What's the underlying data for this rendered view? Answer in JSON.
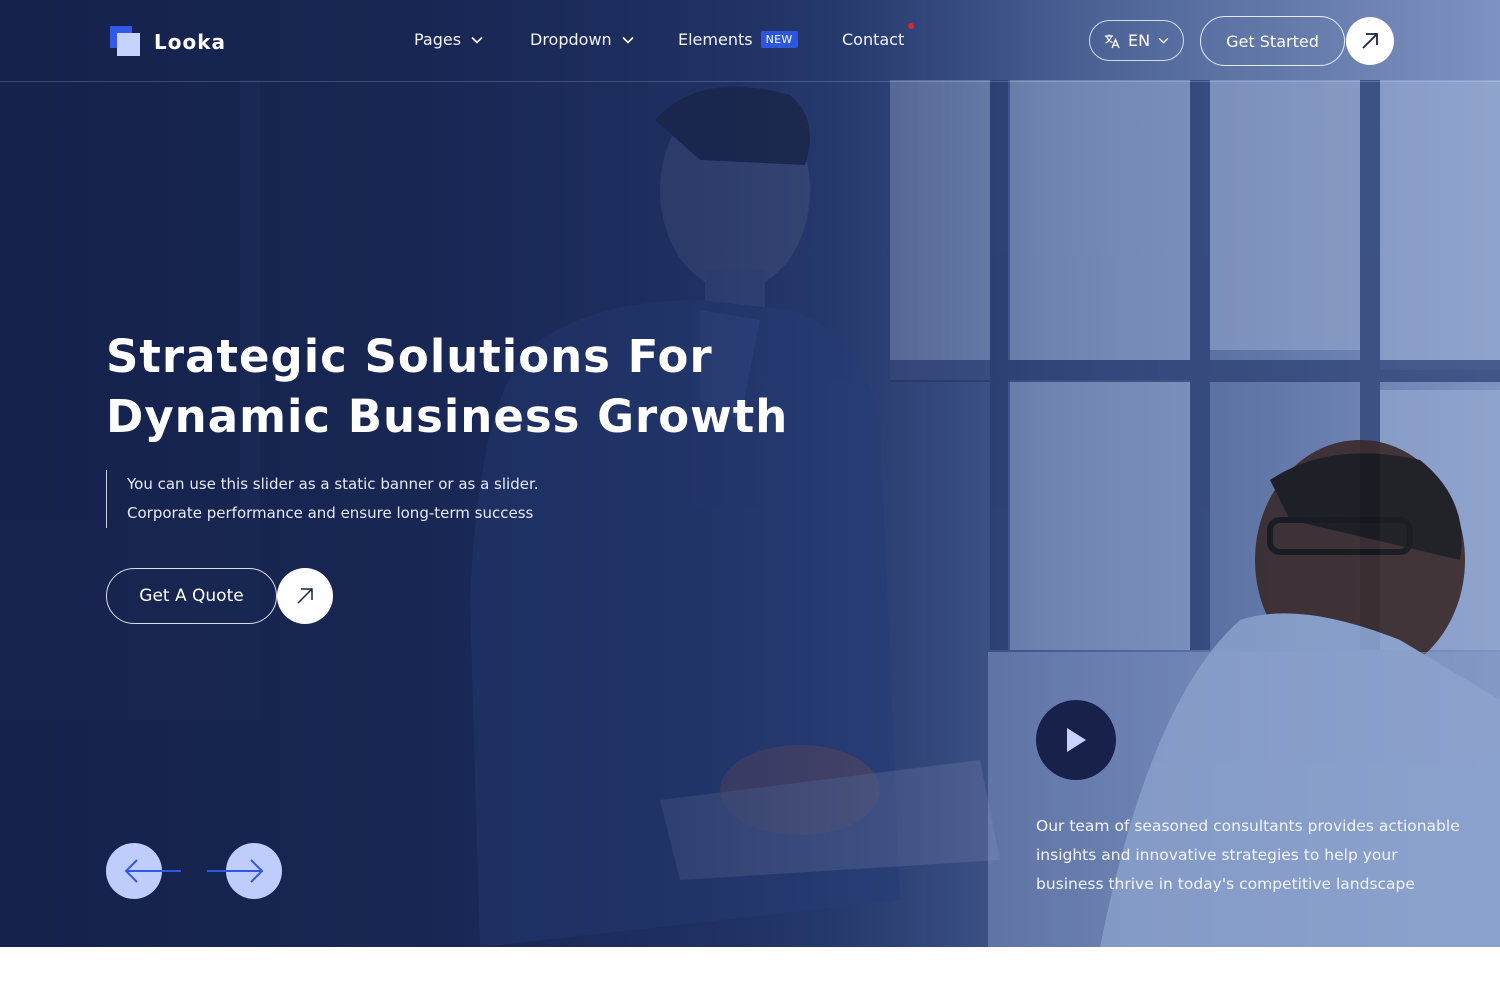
{
  "brand": {
    "name": "Looka",
    "colors": {
      "accent": "#3458e8",
      "dark": "#17214a",
      "badge": "#2c56e0"
    }
  },
  "nav": {
    "items": [
      {
        "label": "Pages",
        "icon": "chevron-down-icon"
      },
      {
        "label": "Dropdown",
        "icon": "chevron-down-icon"
      },
      {
        "label": "Elements",
        "badge": "NEW"
      },
      {
        "label": "Contact"
      }
    ]
  },
  "header_actions": {
    "language": "EN",
    "language_icon": "translate-icon",
    "cta_label": "Get Started",
    "cta_icon": "arrow-up-right-icon"
  },
  "hero": {
    "title_line1": "Strategic Solutions For",
    "title_line2": "Dynamic Business Growth",
    "desc_line1": "You can use this slider as a static banner or as a slider.",
    "desc_line2": "Corporate performance and ensure long-term success",
    "quote_label": "Get A Quote",
    "quote_icon": "arrow-up-right-icon",
    "prev_icon": "arrow-left-icon",
    "next_icon": "arrow-right-icon"
  },
  "panel": {
    "play_icon": "play-icon",
    "text": "Our team of seasoned consultants provides actionable insights and innovative strategies to help your business thrive in today's competitive landscape"
  }
}
